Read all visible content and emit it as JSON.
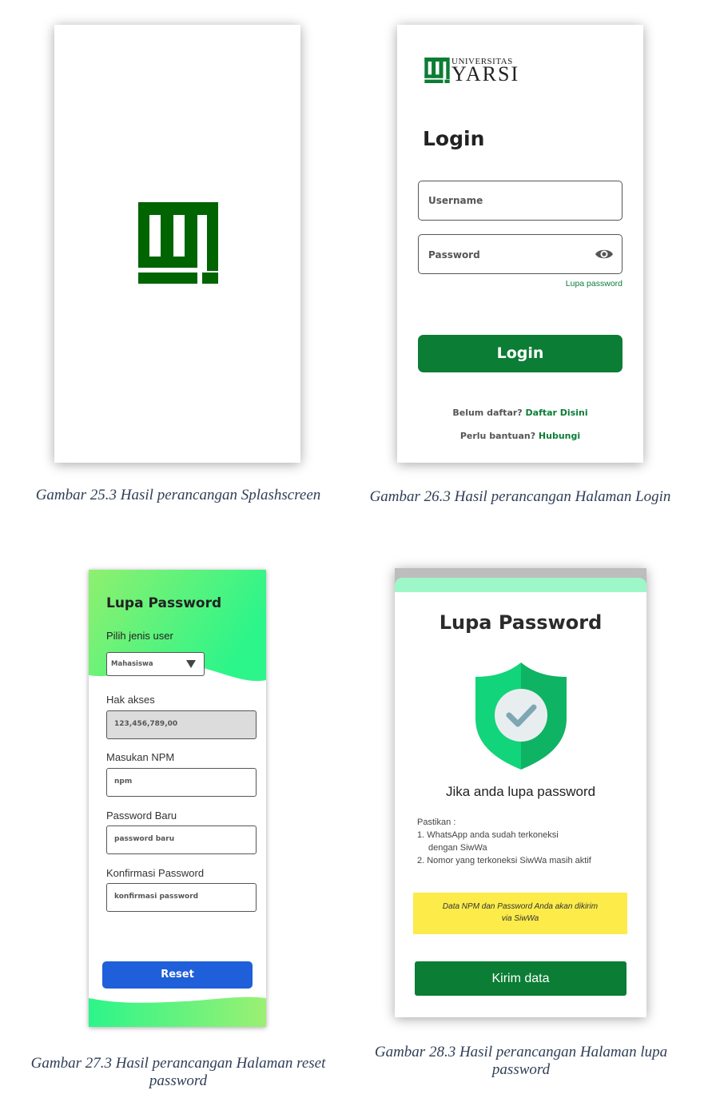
{
  "captions": {
    "c1": "Gambar 25.3 Hasil perancangan Splashscreen",
    "c2": "Gambar 26.3 Hasil perancangan Halaman Login",
    "c3_line1": "Gambar 27.3 Hasil perancangan Halaman reset",
    "c3_line2": "password",
    "c4_line1": "Gambar 28.3 Hasil perancangan Halaman lupa",
    "c4_line2": "password"
  },
  "colors": {
    "brand_green": "#006400",
    "button_green": "#0b7d35",
    "reset_blue": "#1f5fd9",
    "notice_yellow": "#fdeb4a"
  },
  "login": {
    "brand_line1": "UNIVERSITAS",
    "brand_line2": "YARSI",
    "title": "Login",
    "username_label": "Username",
    "password_label": "Password",
    "eye_icon": "eye-icon",
    "forgot_link": "Lupa password",
    "login_button": "Login",
    "register_prompt": "Belum daftar?",
    "register_link": "Daftar Disini",
    "help_prompt": "Perlu bantuan?",
    "help_link": "Hubungi"
  },
  "reset": {
    "title": "Lupa Password",
    "user_type_label": "Pilih jenis user",
    "user_type_value": "Mahasiswa",
    "access_label": "Hak akses",
    "access_value": "123,456,789,00",
    "npm_label": "Masukan NPM",
    "npm_placeholder": "npm",
    "new_password_label": "Password Baru",
    "new_password_placeholder": "password baru",
    "confirm_label": "Konfirmasi Password",
    "confirm_placeholder": "konfirmasi password",
    "reset_button": "Reset"
  },
  "lupa": {
    "title": "Lupa Password",
    "subtitle": "Jika anda lupa password",
    "intro": "Pastikan :",
    "item1a": "1. WhatsApp anda sudah terkoneksi",
    "item1b": "dengan SiwWa",
    "item2": "2. Nomor yang terkoneksi SiwWa masih aktif",
    "notice_line1": "Data NPM dan Password Anda akan dikirim",
    "notice_line2": "via SiwWa",
    "send_button": "Kirim data"
  }
}
